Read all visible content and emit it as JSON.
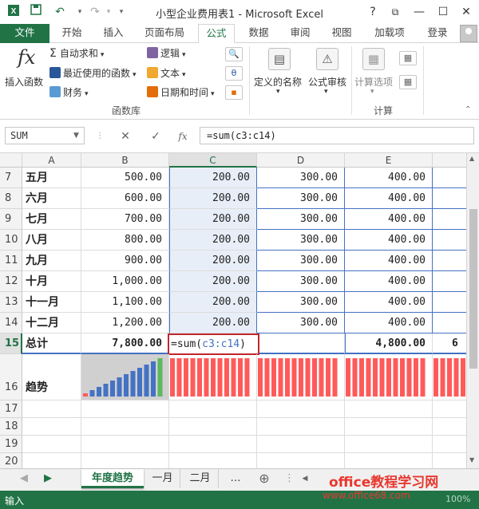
{
  "titlebar": {
    "title": "小型企业费用表1 - Microsoft Excel",
    "help": "?",
    "restore": "⧉",
    "minimize": "—",
    "maximize": "☐",
    "close": "✕",
    "save_icon": "save-icon",
    "undo_icon": "undo-icon",
    "redo_icon": "redo-icon"
  },
  "tabs": {
    "file": "文件",
    "items": [
      "开始",
      "插入",
      "页面布局",
      "公式",
      "数据",
      "审阅",
      "视图",
      "加载项"
    ],
    "active": "公式",
    "login": "登录"
  },
  "ribbon": {
    "insert_function": "插入函数",
    "autosum": "自动求和",
    "recent": "最近使用的函数",
    "finance": "财务",
    "logic": "逻辑",
    "text": "文本",
    "datetime": "日期和时间",
    "defined_names": "定义的名称",
    "audit": "公式审核",
    "calc_options": "计算选项",
    "group_function_library": "函数库",
    "group_calc": "计算",
    "fx_glyph": "fx",
    "sigma_glyph": "Σ"
  },
  "formulabar": {
    "namebox": "SUM",
    "cancel": "✕",
    "enter": "✓",
    "fx": "fx",
    "formula": "=sum(c3:c14)"
  },
  "grid": {
    "columns": [
      "A",
      "B",
      "C",
      "D",
      "E"
    ],
    "selected_column": "C",
    "rows": [
      {
        "n": "7",
        "a": "五月",
        "b": "500.00",
        "c": "200.00",
        "d": "300.00",
        "e": "400.00"
      },
      {
        "n": "8",
        "a": "六月",
        "b": "600.00",
        "c": "200.00",
        "d": "300.00",
        "e": "400.00"
      },
      {
        "n": "9",
        "a": "七月",
        "b": "700.00",
        "c": "200.00",
        "d": "300.00",
        "e": "400.00"
      },
      {
        "n": "10",
        "a": "八月",
        "b": "800.00",
        "c": "200.00",
        "d": "300.00",
        "e": "400.00"
      },
      {
        "n": "11",
        "a": "九月",
        "b": "900.00",
        "c": "200.00",
        "d": "300.00",
        "e": "400.00"
      },
      {
        "n": "12",
        "a": "十月",
        "b": "1,000.00",
        "c": "200.00",
        "d": "300.00",
        "e": "400.00"
      },
      {
        "n": "13",
        "a": "十一月",
        "b": "1,100.00",
        "c": "200.00",
        "d": "300.00",
        "e": "400.00"
      },
      {
        "n": "14",
        "a": "十二月",
        "b": "1,200.00",
        "c": "200.00",
        "d": "300.00",
        "e": "400.00"
      }
    ],
    "total_row": {
      "n": "15",
      "a": "总计",
      "b": "7,800.00",
      "edit_prefix": "=sum(",
      "edit_ref": "c3:c14",
      "edit_suffix": ")",
      "e": "4,800.00",
      "f_partial": "6"
    },
    "trend_row": {
      "n": "16",
      "a": "趋势"
    },
    "empty_rows": [
      "17",
      "18",
      "19",
      "20"
    ],
    "sparkline_b": [
      1,
      2,
      3,
      4,
      5,
      6,
      7,
      8,
      9,
      10,
      11,
      12
    ],
    "sparkline_color_blue": "#4472c4",
    "sparkline_color_green": "#5cb85c",
    "sparkline_color_red": "#ff5a5a"
  },
  "sheets": {
    "items": [
      "年度趋势",
      "一月",
      "二月"
    ],
    "active": "年度趋势",
    "more": "…",
    "add": "⊕"
  },
  "status": {
    "mode": "输入",
    "zoom": "100%"
  },
  "watermark": {
    "line1": "office教程学习网",
    "line2": "www.office68.com"
  },
  "colors": {
    "excel_green": "#217346",
    "selection_red": "#c0272d",
    "ref_blue": "#4472c4"
  }
}
